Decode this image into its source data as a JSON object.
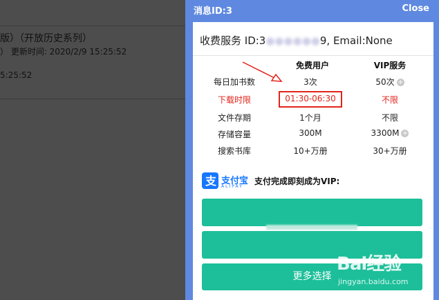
{
  "background": {
    "line1": "版）（开放历史系列）",
    "line2": "）  更新时间: 2020/2/9 15:25:52",
    "line3": "5:25:52"
  },
  "dialog": {
    "title": "消息ID:3",
    "close_label": "Close",
    "service_id": "收费服务 ID:3",
    "service_id_suffix": "9, Email:None",
    "columns": {
      "free": "免费用户",
      "vip": "VIP服务"
    },
    "rows": [
      {
        "label": "每日加书数",
        "free": "3次",
        "vip": "50次",
        "vip_plus": true
      },
      {
        "label": "下载时限",
        "free": "01:30-06:30",
        "vip": "不限",
        "highlight": true
      },
      {
        "label": "文件存期",
        "free": "1个月",
        "vip": "不限"
      },
      {
        "label": "存储容量",
        "free": "300M",
        "vip": "3300M",
        "vip_plus": true
      },
      {
        "label": "搜索书库",
        "free": "10+万册",
        "vip": "30+万册"
      }
    ],
    "alipay": {
      "brand": "支付宝",
      "sub": "ALIPAY",
      "message": "支付完成即刻成为VIP:"
    },
    "buttons": {
      "option1": "",
      "option2": "",
      "more": "更多选择"
    }
  },
  "watermark": {
    "brand": "Bai经验",
    "url": "jingyan.baidu.com"
  },
  "colors": {
    "accent_blue": "#5f89e0",
    "button_green": "#1cbf9a",
    "alert_red": "#e2231a",
    "alipay_blue": "#1677ff"
  }
}
